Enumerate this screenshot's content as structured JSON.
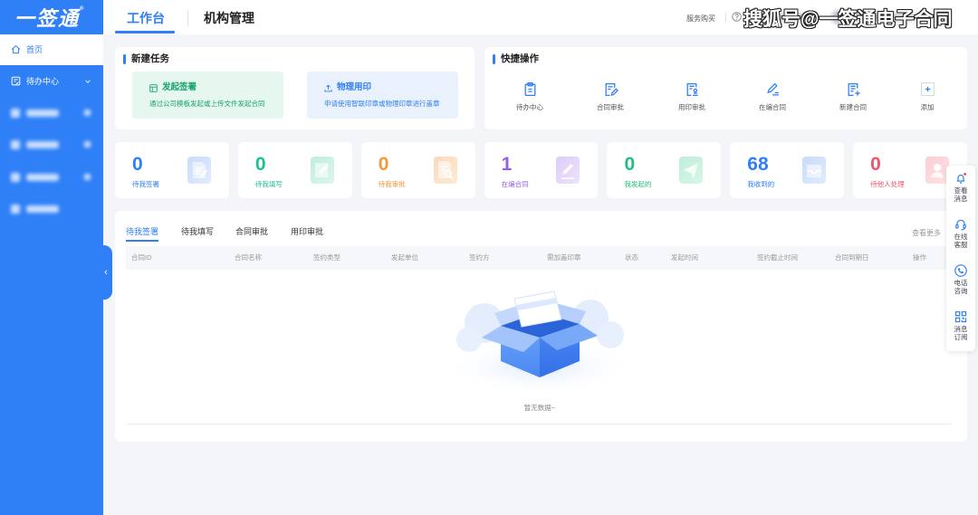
{
  "sidebar": {
    "logo": "一签通",
    "logo_mark": "®",
    "items": [
      {
        "label": "首页",
        "icon": "home-icon",
        "active": true
      },
      {
        "label": "待办中心",
        "icon": "todo-icon",
        "expandable": true
      }
    ],
    "collapse_icon": "chevron-left-icon",
    "collapse_glyph": "‹"
  },
  "header": {
    "tabs": [
      {
        "label": "工作台",
        "active": true
      },
      {
        "label": "机构管理",
        "active": false
      }
    ],
    "service_purchase": "服务购买",
    "help_icon": "help-icon"
  },
  "watermark": "搜狐号@一签通电子合同",
  "colors": {
    "brand": "#2f7ff7",
    "page_bg": "#f3f5f9"
  },
  "new_task": {
    "title": "新建任务",
    "cards": [
      {
        "title": "发起签署",
        "desc": "通过公司模板发起或上传文件发起合同",
        "icon": "template-icon",
        "color": "#17a468",
        "bg": "#e6f7f0"
      },
      {
        "title": "物理用印",
        "desc": "申请使用智联印章或物理印章进行盖章",
        "icon": "upload-icon",
        "color": "#2f7ff7",
        "bg": "#e9f1fd"
      }
    ]
  },
  "quick_actions": {
    "title": "快捷操作",
    "items": [
      {
        "label": "待办中心",
        "icon": "clipboard-icon"
      },
      {
        "label": "合同审批",
        "icon": "doc-edit-icon"
      },
      {
        "label": "用印审批",
        "icon": "doc-stamp-icon"
      },
      {
        "label": "在编合同",
        "icon": "pen-icon"
      },
      {
        "label": "新建合同",
        "icon": "doc-add-icon"
      },
      {
        "label": "添加",
        "icon": "add-icon"
      }
    ]
  },
  "stats": [
    {
      "value": 0,
      "label": "待我签署",
      "color": "#2f7ff7",
      "icon": "sign-doc-icon",
      "icon_bg": "#c9dcfb"
    },
    {
      "value": 0,
      "label": "待我填写",
      "color": "#1dbf9b",
      "icon": "write-icon",
      "icon_bg": "#bfeede"
    },
    {
      "value": 0,
      "label": "待我审批",
      "color": "#f7963a",
      "icon": "review-icon",
      "icon_bg": "#fcd9b8"
    },
    {
      "value": 1,
      "label": "在编合同",
      "color": "#9b5de5",
      "icon": "editing-icon",
      "icon_bg": "#dccdfa"
    },
    {
      "value": 0,
      "label": "我发起的",
      "color": "#21c07f",
      "icon": "send-icon",
      "icon_bg": "#bdeed8"
    },
    {
      "value": 68,
      "label": "我收到的",
      "color": "#2f7ff7",
      "icon": "inbox-icon",
      "icon_bg": "#c9dbfa"
    },
    {
      "value": 0,
      "label": "待他人处理",
      "color": "#f0566a",
      "icon": "person-icon",
      "icon_bg": "#fccdd3"
    }
  ],
  "table": {
    "tabs": [
      {
        "label": "待我签署",
        "active": true
      },
      {
        "label": "待我填写"
      },
      {
        "label": "合同审批"
      },
      {
        "label": "用印审批"
      }
    ],
    "more": "查看更多",
    "columns": [
      "合同ID",
      "合同名称",
      "签约类型",
      "发起单位",
      "签约方",
      "需加盖印章",
      "状态",
      "发起时间",
      "签约截止时间",
      "合同到期日",
      "操作"
    ],
    "rows": [],
    "empty_text": "暂无数据~",
    "empty_icon": "empty-box-icon"
  },
  "float_panel": [
    {
      "label": "查看消息",
      "icon": "bell-icon",
      "badge": true
    },
    {
      "label": "在线客服",
      "icon": "headset-icon"
    },
    {
      "label": "电话咨询",
      "icon": "phone-icon"
    },
    {
      "label": "消息订阅",
      "icon": "qr-code-icon"
    }
  ]
}
